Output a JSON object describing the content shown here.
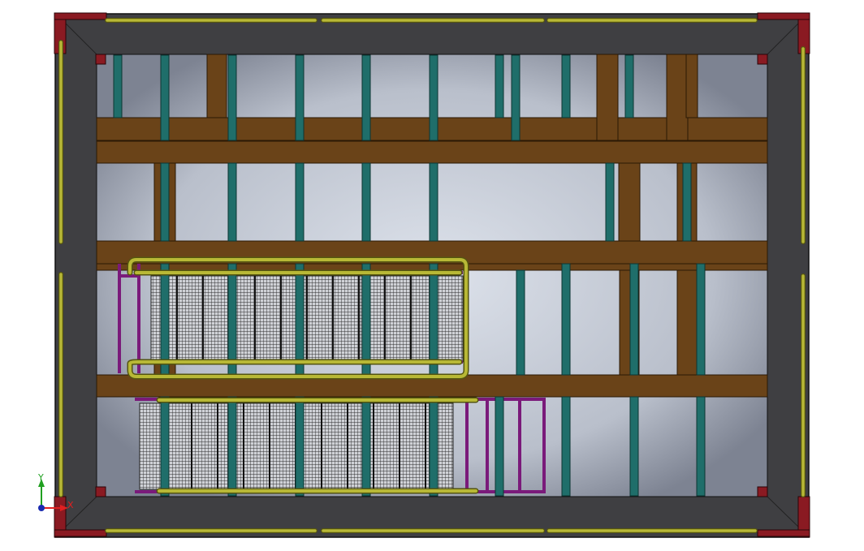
{
  "viewport": {
    "background": "#ffffff"
  },
  "colors": {
    "frame_dark": "#3f3f42",
    "frame_edge": "#1a1a1a",
    "corner": "#8a1a22",
    "pipe": "#a9a92a",
    "pipe_dark": "#55550f",
    "beam": "#6a4318",
    "beam_dark": "#3e2608",
    "post": "#1f6e6a",
    "post_dark": "#0c3533",
    "rail": "#7a1a7a",
    "grate": "#c9cbd0",
    "grate_line": "#2d2d2d",
    "bay_mid": "#d6dbe5",
    "bay_edge": "#7d8392"
  },
  "triad": {
    "x_label": "X",
    "y_label": "Y",
    "x_color": "#e02020",
    "y_color": "#20a020",
    "origin_color": "#1a2ab0"
  }
}
